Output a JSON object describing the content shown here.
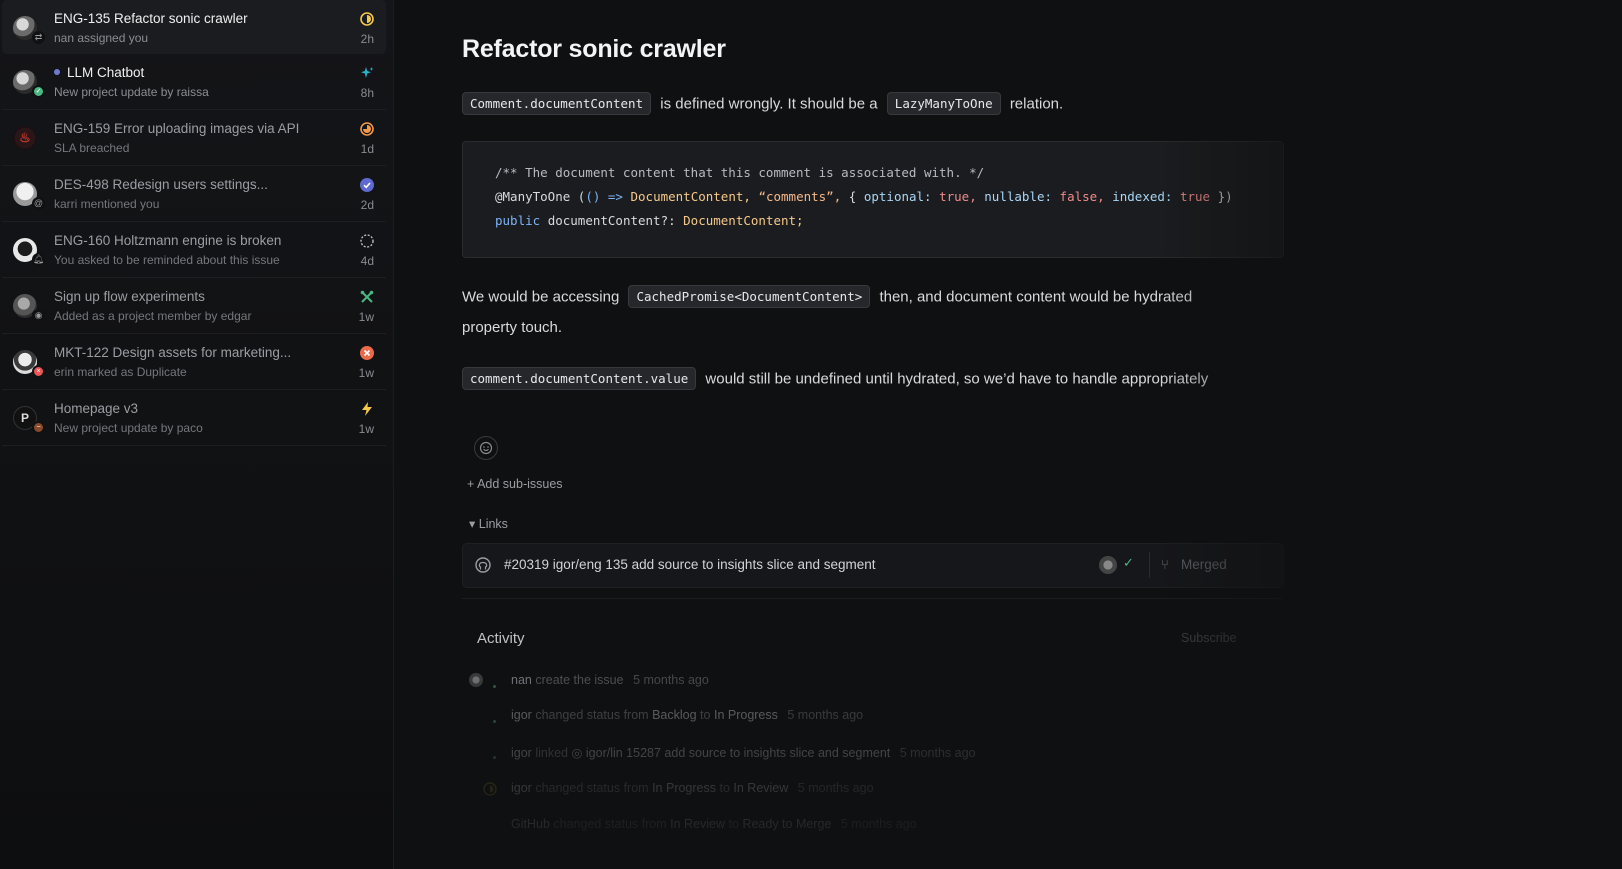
{
  "inbox": [
    {
      "title": "ENG-135 Refactor sonic crawler",
      "subtitle": "nan assigned you",
      "time": "2h",
      "status_icon": "in-review-icon",
      "badge_icon": "reassign-icon",
      "unread": true,
      "active": true
    },
    {
      "title": "LLM Chatbot",
      "subtitle": "New project update by raissa",
      "time": "8h",
      "status_icon": "sparkle-icon",
      "badge_icon": "on-track-icon",
      "unread": true,
      "active": false,
      "dot": true
    },
    {
      "title": "ENG-159 Error uploading images via API",
      "subtitle": "SLA breached",
      "time": "1d",
      "status_icon": "in-progress-icon",
      "badge_icon": "fire-icon",
      "unread": false,
      "active": false
    },
    {
      "title": "DES-498 Redesign users settings...",
      "subtitle": "karri mentioned you",
      "time": "2d",
      "status_icon": "done-icon",
      "badge_icon": "mention-icon",
      "unread": false,
      "active": false
    },
    {
      "title": "ENG-160 Holtzmann engine is broken",
      "subtitle": "You asked to be reminded about this issue",
      "time": "4d",
      "status_icon": "backlog-icon",
      "badge_icon": "bell-icon",
      "unread": false,
      "active": false
    },
    {
      "title": "Sign up flow experiments",
      "subtitle": "Added as a project member by edgar",
      "time": "1w",
      "status_icon": "tools-icon",
      "badge_icon": "member-icon",
      "unread": false,
      "active": false
    },
    {
      "title": "MKT-122 Design assets for marketing...",
      "subtitle": "erin marked as Duplicate",
      "time": "1w",
      "status_icon": "cancelled-icon",
      "badge_icon": "duplicate-icon",
      "unread": false,
      "active": false
    },
    {
      "title": "Homepage v3",
      "subtitle": "New project update by paco",
      "time": "1w",
      "status_icon": "lightning-icon",
      "badge_icon": "at-risk-icon",
      "unread": false,
      "active": false
    }
  ],
  "issue": {
    "title": "Refactor sonic crawler",
    "p1": {
      "chip1": "Comment.documentContent",
      "text1": "is defined wrongly. It should be a",
      "chip2": "LazyManyToOne",
      "text2": "relation."
    },
    "code": {
      "line1": "/** The document content that this comment is associated with. */",
      "line2_decorator": "@ManyToOne",
      "line2_paren_open": "(",
      "line2_arrow": "() =>",
      "line2_type": "DocumentContent,",
      "line2_str": "“comments”,",
      "line2_brace": "{",
      "line2_opt": "optional:",
      "line2_true": "true,",
      "line2_null": "nullable:",
      "line2_false": "false,",
      "line2_idx": "indexed:",
      "line2_true2": "true",
      "line2_end": "})",
      "line3_kw": "public",
      "line3_name": "documentContent?:",
      "line3_type": "DocumentContent;"
    },
    "p2": {
      "text1": "We would be accessing",
      "chip": "CachedPromise<DocumentContent>",
      "text2": "then, and document content would be hydrated",
      "text3": "property touch."
    },
    "p3": {
      "chip": "comment.documentContent.value",
      "text": "would still be undefined until hydrated, so we’d have to handle appropriately"
    },
    "add_sub_issues": "+ Add sub-issues",
    "links_label": "▾ Links",
    "link": {
      "text": "#20319 igor/eng 135 add source to insights slice and segment",
      "status": "Merged"
    },
    "activity_title": "Activity",
    "subscribe": "Subscribe",
    "activity": [
      {
        "who": "nan",
        "verb": "create the issue",
        "v1": "",
        "mid": "",
        "v2": "",
        "ts": "5 months ago"
      },
      {
        "who": "igor",
        "verb": "changed status from",
        "v1": "Backlog",
        "mid": "to",
        "v2": "In Progress",
        "ts": "5 months ago"
      },
      {
        "who": "igor",
        "verb": "linked",
        "v1": "igor/lin 15287 add source to insights slice and segment",
        "mid": "",
        "v2": "",
        "ts": "5 months ago"
      },
      {
        "who": "igor",
        "verb": "changed status from",
        "v1": "In Progress",
        "mid": "to",
        "v2": "In Review",
        "ts": "5 months ago"
      },
      {
        "who": "GitHub",
        "verb": "changed status from",
        "v1": "In Review",
        "mid": "to",
        "v2": "Ready to Merge",
        "ts": "5 months ago"
      }
    ]
  },
  "colors": {
    "accent": "#6e79d6",
    "in_review": "#f2c94c",
    "in_progress": "#f2994a",
    "done": "#5e6ad2",
    "tools": "#4cb782",
    "cancelled": "#eb5757",
    "lightning": "#f2c94c",
    "sparkle": "#26b5ce"
  }
}
